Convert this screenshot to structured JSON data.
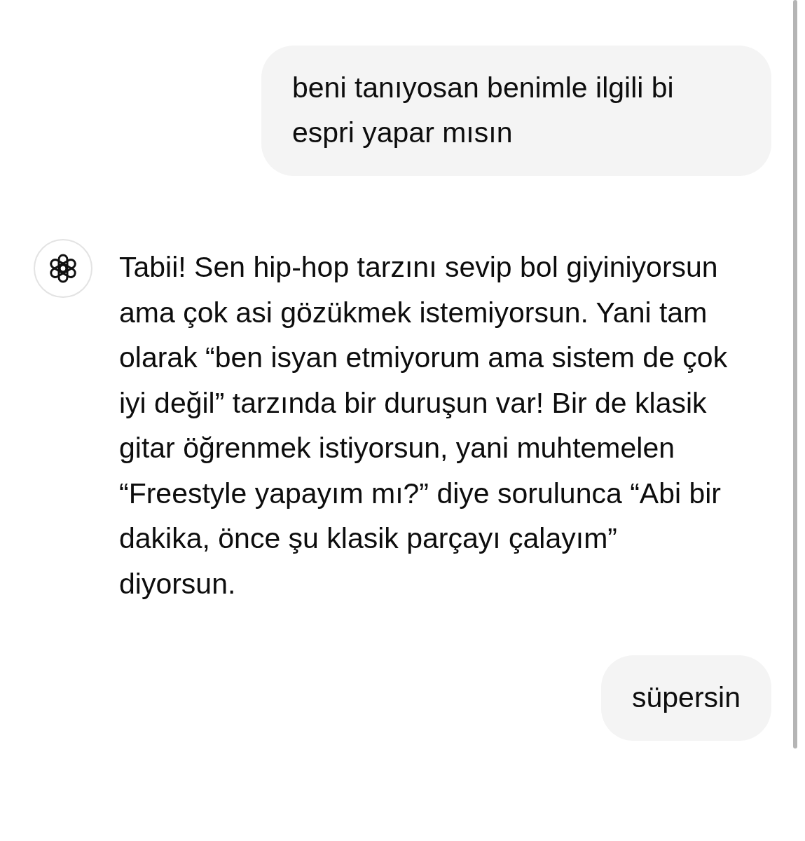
{
  "messages": [
    {
      "kind": "user",
      "text": "beni tanıyosan benimle ilgili bi espri yapar mısın"
    },
    {
      "kind": "assistant",
      "text": "Tabii! Sen hip-hop tarzını sevip bol giyiniyorsun ama çok asi gözükmek istemiyorsun. Yani tam olarak “ben isyan etmiyorum ama sistem de çok iyi değil” tarzında bir duruşun var! Bir de klasik gitar öğrenmek istiyorsun, yani muhtemelen “Freestyle yapayım mı?” diye sorulunca “Abi bir dakika, önce şu klasik parçayı çalayım” diyorsun."
    },
    {
      "kind": "user",
      "text": "süpersin"
    }
  ]
}
